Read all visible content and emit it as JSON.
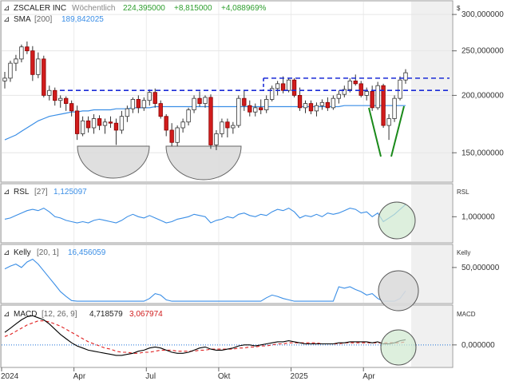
{
  "header": {
    "symbol": "ZSCALER INC",
    "interval": "Wöchentlich",
    "price": "224,395000",
    "change_abs": "+8,815000",
    "change_pct": "+4,088969%",
    "currency": "$"
  },
  "colors": {
    "up": "#2e9e2e",
    "down": "#d11c1c",
    "sma": "#3a8ee6",
    "resistance": "#1a2bd6",
    "macd": "#000000",
    "signal": "#e02020",
    "zero_line": "#1a6fd6",
    "highlight_fill": "#cfe8cf",
    "cup_fill": "#dcdcdc",
    "v_pattern": "#1a8a1a"
  },
  "panels": {
    "price": {
      "sma_label": "SMA",
      "sma_param": "[200]",
      "sma_value": "189,842025",
      "ticks": [
        "300,000000",
        "250,000000",
        "200,000000",
        "150,000000"
      ]
    },
    "rsl": {
      "label": "RSL",
      "param": "[27]",
      "value": "1,125097",
      "axis_title": "RSL",
      "ticks": [
        "1,000000"
      ]
    },
    "kelly": {
      "label": "Kelly",
      "param": "[20, 1]",
      "value": "16,456059",
      "axis_title": "Kelly",
      "ticks": [
        "50,000000"
      ]
    },
    "macd": {
      "label": "MACD",
      "param": "[12, 26, 9]",
      "value1": "4,718579",
      "value2": "3,067974",
      "axis_title": "MACD",
      "ticks": [
        "0,000000"
      ]
    }
  },
  "x_axis": {
    "labels": [
      "2024",
      "Apr",
      "Jul",
      "Okt",
      "2025",
      "Apr"
    ]
  },
  "chart_data": [
    {
      "type": "candlestick",
      "title": "ZSCALER INC",
      "y_scale": "log",
      "ylim": [
        130,
        320
      ],
      "resistance_levels": [
        218,
        205
      ],
      "sma_200": [
        160,
        162,
        164,
        167,
        170,
        173,
        176,
        178,
        180,
        181,
        182,
        183,
        184,
        184,
        185,
        185,
        186,
        186,
        186,
        186,
        187,
        187,
        187,
        188,
        188,
        188,
        188,
        189,
        189,
        189,
        189,
        189,
        189,
        189,
        189,
        189,
        189,
        189,
        189,
        189,
        189,
        189,
        189,
        189,
        189,
        189,
        189,
        189,
        189,
        189,
        189,
        189,
        189,
        189,
        189,
        189,
        189,
        189,
        189,
        189,
        189,
        190,
        190,
        190,
        190,
        190,
        190,
        190,
        190,
        190,
        190,
        190,
        190,
        190,
        190,
        190,
        190,
        190,
        190,
        190,
        190,
        190,
        190,
        190,
        190,
        190,
        190,
        190,
        190,
        190,
        190,
        190,
        190,
        190,
        190,
        190,
        190,
        190,
        190,
        190,
        190,
        190,
        190,
        190,
        190,
        190,
        190,
        190,
        190,
        190,
        190,
        190,
        190,
        190
      ],
      "candles": [
        [
          215,
          225,
          207,
          218
        ],
        [
          218,
          238,
          214,
          235
        ],
        [
          235,
          245,
          226,
          240
        ],
        [
          240,
          258,
          236,
          255
        ],
        [
          255,
          262,
          246,
          250
        ],
        [
          250,
          256,
          215,
          222
        ],
        [
          222,
          248,
          218,
          240
        ],
        [
          240,
          244,
          198,
          200
        ],
        [
          200,
          210,
          195,
          205
        ],
        [
          205,
          208,
          190,
          195
        ],
        [
          195,
          200,
          188,
          197
        ],
        [
          197,
          199,
          185,
          192
        ],
        [
          192,
          195,
          180,
          185
        ],
        [
          185,
          190,
          160,
          165
        ],
        [
          165,
          180,
          163,
          176
        ],
        [
          176,
          180,
          166,
          170
        ],
        [
          170,
          182,
          165,
          178
        ],
        [
          178,
          181,
          168,
          172
        ],
        [
          172,
          178,
          165,
          175
        ],
        [
          175,
          180,
          170,
          174
        ],
        [
          174,
          178,
          156,
          168
        ],
        [
          168,
          185,
          165,
          180
        ],
        [
          180,
          190,
          175,
          187
        ],
        [
          187,
          198,
          183,
          196
        ],
        [
          196,
          200,
          183,
          188
        ],
        [
          188,
          198,
          185,
          195
        ],
        [
          195,
          206,
          190,
          203
        ],
        [
          203,
          207,
          188,
          192
        ],
        [
          192,
          195,
          178,
          180
        ],
        [
          180,
          182,
          163,
          168
        ],
        [
          168,
          174,
          155,
          158
        ],
        [
          158,
          172,
          155,
          170
        ],
        [
          170,
          178,
          166,
          175
        ],
        [
          175,
          188,
          172,
          186
        ],
        [
          186,
          200,
          183,
          197
        ],
        [
          197,
          204,
          189,
          192
        ],
        [
          192,
          200,
          188,
          198
        ],
        [
          198,
          201,
          153,
          156
        ],
        [
          156,
          168,
          152,
          165
        ],
        [
          165,
          178,
          162,
          175
        ],
        [
          175,
          178,
          162,
          170
        ],
        [
          170,
          175,
          165,
          172
        ],
        [
          172,
          200,
          170,
          197
        ],
        [
          197,
          205,
          185,
          190
        ],
        [
          190,
          195,
          180,
          184
        ],
        [
          184,
          192,
          180,
          188
        ],
        [
          188,
          196,
          182,
          186
        ],
        [
          186,
          200,
          183,
          196
        ],
        [
          196,
          210,
          194,
          207
        ],
        [
          207,
          215,
          200,
          212
        ],
        [
          212,
          220,
          202,
          205
        ],
        [
          205,
          218,
          203,
          216
        ],
        [
          216,
          218,
          198,
          200
        ],
        [
          200,
          208,
          185,
          188
        ],
        [
          188,
          195,
          183,
          192
        ],
        [
          192,
          195,
          182,
          185
        ],
        [
          185,
          193,
          180,
          190
        ],
        [
          190,
          196,
          186,
          193
        ],
        [
          193,
          198,
          185,
          188
        ],
        [
          188,
          200,
          186,
          197
        ],
        [
          197,
          205,
          192,
          201
        ],
        [
          201,
          210,
          198,
          206
        ],
        [
          206,
          218,
          203,
          215
        ],
        [
          215,
          222,
          210,
          212
        ],
        [
          212,
          215,
          198,
          200
        ],
        [
          200,
          208,
          195,
          204
        ],
        [
          204,
          210,
          185,
          188
        ],
        [
          188,
          214,
          186,
          210
        ],
        [
          210,
          212,
          170,
          172
        ],
        [
          172,
          182,
          160,
          178
        ],
        [
          178,
          200,
          175,
          197
        ],
        [
          197,
          220,
          195,
          216
        ],
        [
          216,
          228,
          212,
          224
        ]
      ]
    },
    {
      "type": "line",
      "title": "RSL [27]",
      "ylim": [
        0.8,
        1.25
      ],
      "values": [
        0.98,
        0.99,
        1.01,
        1.03,
        1.05,
        1.06,
        1.05,
        1.07,
        1.04,
        1.0,
        0.99,
        0.97,
        0.96,
        0.95,
        0.96,
        0.95,
        0.97,
        0.98,
        0.97,
        0.96,
        0.95,
        0.97,
        1.0,
        1.02,
        1.0,
        0.99,
        1.01,
        0.99,
        0.97,
        0.95,
        0.96,
        0.98,
        0.99,
        1.0,
        1.02,
        1.01,
        1.0,
        0.95,
        0.97,
        0.98,
        1.0,
        0.99,
        1.02,
        1.03,
        1.01,
        1.0,
        1.02,
        1.01,
        1.04,
        1.06,
        1.05,
        1.07,
        1.04,
        0.99,
        1.01,
        1.0,
        1.02,
        1.0,
        1.03,
        1.02,
        1.03,
        1.05,
        1.07,
        1.06,
        1.03,
        1.04,
        1.0,
        1.03,
        0.96,
        0.99,
        1.02,
        1.06,
        1.1
      ]
    },
    {
      "type": "line",
      "title": "Kelly [20, 1]",
      "ylim": [
        0,
        80
      ],
      "values": [
        48,
        52,
        55,
        50,
        58,
        62,
        55,
        45,
        35,
        25,
        15,
        8,
        2,
        1,
        1,
        1,
        1,
        1,
        1,
        1,
        1,
        1,
        1,
        1,
        1,
        1,
        5,
        12,
        10,
        3,
        1,
        1,
        1,
        1,
        1,
        1,
        1,
        1,
        1,
        1,
        1,
        1,
        1,
        1,
        1,
        1,
        1,
        6,
        10,
        8,
        5,
        3,
        1,
        1,
        1,
        1,
        1,
        1,
        1,
        1,
        22,
        20,
        22,
        18,
        15,
        10,
        12,
        5,
        1,
        1,
        1,
        5,
        16
      ]
    },
    {
      "type": "line",
      "title": "MACD [12, 26, 9]",
      "ylim": [
        -20,
        35
      ],
      "series": [
        {
          "name": "MACD",
          "values": [
            12,
            16,
            20,
            24,
            27,
            28,
            26,
            24,
            20,
            15,
            10,
            6,
            2,
            -1,
            -3,
            -5,
            -6,
            -7,
            -8,
            -9,
            -10,
            -10,
            -9,
            -8,
            -6,
            -5,
            -3,
            -2,
            -3,
            -5,
            -7,
            -8,
            -8,
            -7,
            -5,
            -3,
            -2,
            -4,
            -5,
            -5,
            -4,
            -3,
            -1,
            0,
            0,
            -1,
            0,
            1,
            2,
            3,
            3,
            4,
            3,
            2,
            1,
            1,
            1,
            1,
            1,
            1,
            2,
            2,
            3,
            3,
            3,
            3,
            2,
            3,
            1,
            1,
            2,
            4,
            5
          ]
        },
        {
          "name": "Signal",
          "values": [
            8,
            10,
            13,
            16,
            19,
            21,
            23,
            23,
            22,
            20,
            18,
            15,
            12,
            9,
            6,
            3,
            1,
            -1,
            -3,
            -4,
            -6,
            -7,
            -7,
            -8,
            -8,
            -7,
            -7,
            -6,
            -5,
            -5,
            -5,
            -6,
            -6,
            -6,
            -6,
            -5,
            -5,
            -4,
            -4,
            -4,
            -4,
            -4,
            -3,
            -3,
            -2,
            -2,
            -1,
            -1,
            0,
            1,
            1,
            2,
            2,
            2,
            2,
            2,
            2,
            1,
            1,
            1,
            1,
            2,
            2,
            2,
            2,
            2,
            2,
            2,
            2,
            2,
            2,
            2,
            3
          ]
        }
      ]
    }
  ]
}
